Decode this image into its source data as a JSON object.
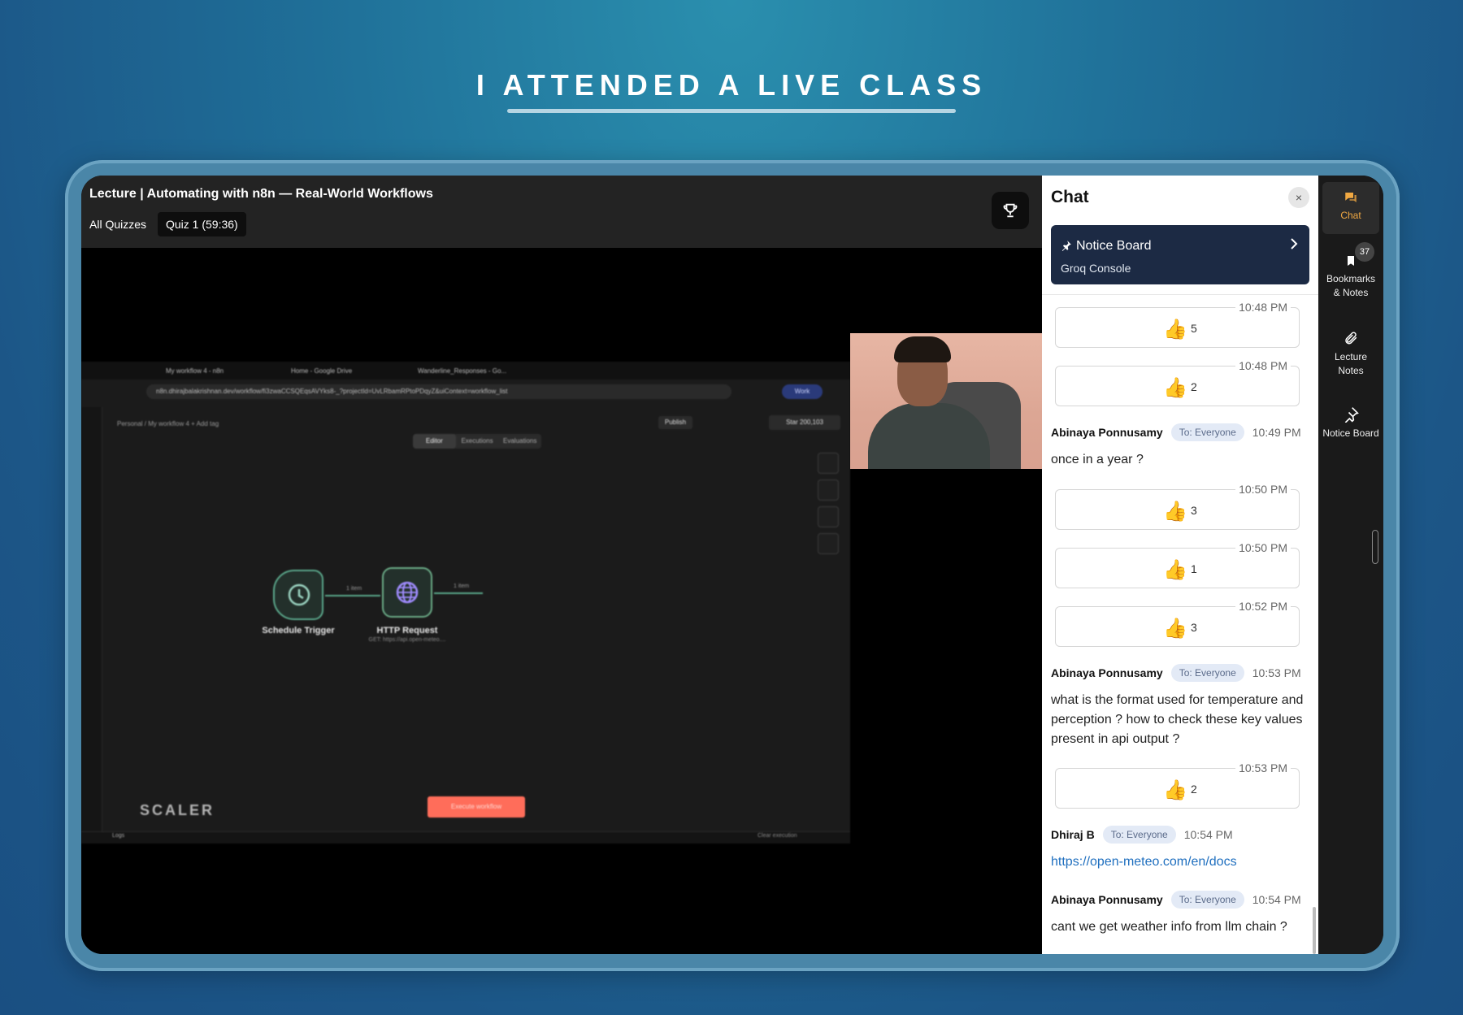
{
  "headline": "I ATTENDED A LIVE CLASS",
  "lecture": {
    "title": "Lecture | Automating with n8n — Real-World Workflows",
    "all_quizzes": "All Quizzes",
    "quiz_pill": "Quiz 1 (59:36)"
  },
  "shared_screen": {
    "tabs": [
      "My workflow 4 - n8n",
      "Home - Google Drive",
      "Wanderline_Responses - Go..."
    ],
    "url": "n8n.dhirajbalakrishnan.dev/workflow/fi3zwaCCSQEqsAVYks8-_?projectId=UvLRbamRPtoPDqyZ&uiContext=workflow_list",
    "work_label": "Work",
    "breadcrumb": "Personal / My workflow 4 + Add tag",
    "publish": "Publish",
    "star": "Star 200,103",
    "modes": [
      "Editor",
      "Executions",
      "Evaluations"
    ],
    "node_trigger": "Schedule Trigger",
    "node_http": "HTTP Request",
    "node_http_sub": "GET: https://api.open-meteo....",
    "edge1": "1 item",
    "edge2": "1 item",
    "execute_button": "Execute workflow",
    "watermark": "SCALER",
    "logs": "Logs",
    "clear_execution": "Clear execution"
  },
  "chat": {
    "title": "Chat",
    "close": "×",
    "notice_board": {
      "title": "Notice Board",
      "subtitle": "Groq Console"
    },
    "reactions": [
      {
        "time": "10:48 PM",
        "emoji": "👍",
        "count": "5"
      },
      {
        "time": "10:48 PM",
        "emoji": "👍",
        "count": "2"
      },
      {
        "time": "10:50 PM",
        "emoji": "👍",
        "count": "3"
      },
      {
        "time": "10:50 PM",
        "emoji": "👍",
        "count": "1"
      },
      {
        "time": "10:52 PM",
        "emoji": "👍",
        "count": "3"
      },
      {
        "time": "10:53 PM",
        "emoji": "👍",
        "count": "2"
      }
    ],
    "messages": [
      {
        "author": "Abinaya Ponnusamy",
        "to": "To: Everyone",
        "time": "10:49 PM",
        "text": "once in a year ?"
      },
      {
        "author": "Abinaya Ponnusamy",
        "to": "To: Everyone",
        "time": "10:53 PM",
        "text": "what is the format used for temperature and perception ? how to check these key values present in api output ?"
      },
      {
        "author": "Dhiraj B",
        "to": "To: Everyone",
        "time": "10:54 PM",
        "text": "https://open-meteo.com/en/docs"
      },
      {
        "author": "Abinaya Ponnusamy",
        "to": "To: Everyone",
        "time": "10:54 PM",
        "text": "cant we get weather info from llm chain ?"
      }
    ]
  },
  "rail": {
    "chat": "Chat",
    "bookmarks": "Bookmarks & Notes",
    "bookmarks_badge": "37",
    "lecture_notes": "Lecture Notes",
    "notice_board": "Notice Board"
  },
  "colors": {
    "accent": "#f0a842",
    "notice_bg": "#1c2a44",
    "link": "#1f6fbf",
    "n8n_node_border": "#5aa68a",
    "execute_button": "#ff6d5a"
  }
}
